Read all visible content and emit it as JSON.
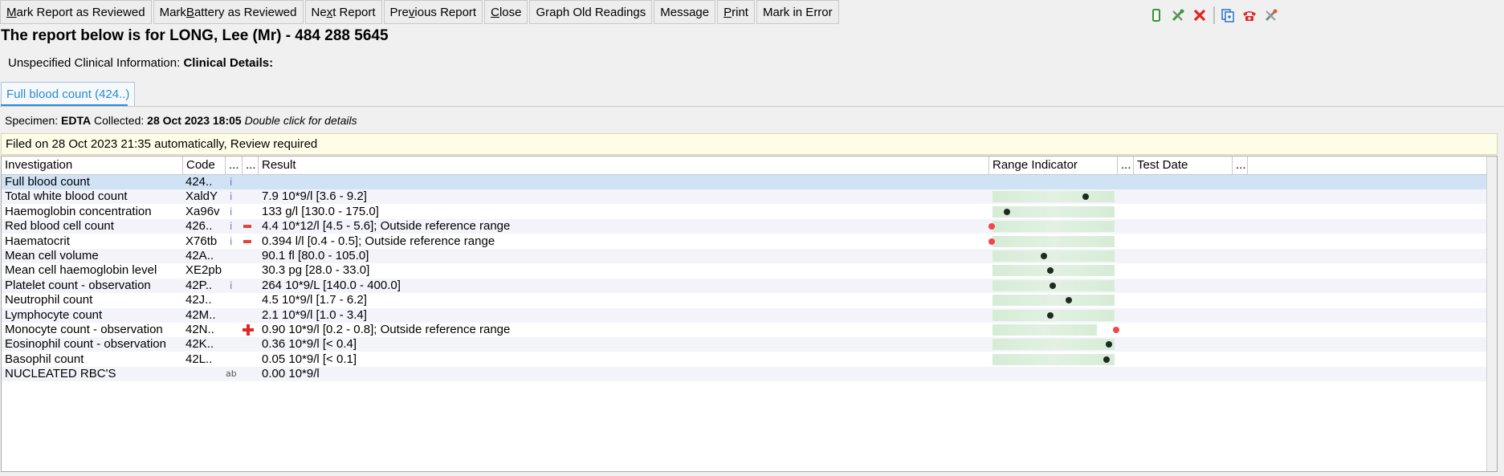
{
  "toolbar": {
    "buttons": [
      {
        "pre": "",
        "ul": "M",
        "post": "ark Report as Reviewed"
      },
      {
        "pre": "Mark ",
        "ul": "B",
        "post": "attery as Reviewed"
      },
      {
        "pre": "Ne",
        "ul": "x",
        "post": "t Report"
      },
      {
        "pre": "Pre",
        "ul": "v",
        "post": "ious Report"
      },
      {
        "pre": "",
        "ul": "C",
        "post": "lose"
      },
      {
        "pre": "Graph Old Readings",
        "ul": "",
        "post": ""
      },
      {
        "pre": "Message",
        "ul": "",
        "post": ""
      },
      {
        "pre": "",
        "ul": "P",
        "post": "rint"
      },
      {
        "pre": "Mark in Error",
        "ul": "",
        "post": ""
      }
    ],
    "icons": [
      "phone-icon",
      "tools-icon",
      "close-red-icon",
      "copy-icon",
      "telephone-icon",
      "tools-grey-icon"
    ]
  },
  "report_title": "The report below is for LONG, Lee (Mr) - 484 288 5645",
  "clinical": {
    "label": "Unspecified Clinical Information:",
    "value": "Clinical Details:"
  },
  "tab": {
    "label": "Full blood count (424..)"
  },
  "specimen": {
    "label": "Specimen:",
    "type": "EDTA",
    "collected_label": "Collected:",
    "collected": "28 Oct 2023 18:05",
    "hint": "Double click for details"
  },
  "filed_banner": "Filed on 28 Oct 2023 21:35 automatically, Review required",
  "grid": {
    "columns": [
      "Investigation",
      "Code",
      "...",
      "...",
      "Result",
      "Range Indicator",
      "...",
      "Test Date",
      "..."
    ],
    "rows": [
      {
        "investigation": "Full blood count",
        "code": "424..",
        "info": "i",
        "flag": "",
        "result": "",
        "range": null
      },
      {
        "investigation": "Total white blood count",
        "code": "XaldY",
        "info": "i",
        "flag": "",
        "result": "7.9 10*9/l [3.6 - 9.2]",
        "range": 0.77
      },
      {
        "investigation": "Haemoglobin concentration",
        "code": "Xa96v",
        "info": "i",
        "flag": "",
        "result": "133 g/l [130.0 - 175.0]",
        "range": 0.07
      },
      {
        "investigation": "Red blood cell count",
        "code": "426..",
        "info": "i",
        "flag": "low",
        "result": "4.4 10*12/l [4.5 - 5.6]; Outside reference range",
        "range": -0.1
      },
      {
        "investigation": "Haematocrit",
        "code": "X76tb",
        "info": "i",
        "flag": "low",
        "result": "0.394 l/l [0.4 - 0.5]; Outside reference range",
        "range": -0.1
      },
      {
        "investigation": "Mean cell volume",
        "code": "42A..",
        "info": "",
        "flag": "",
        "result": "90.1 fl [80.0 - 105.0]",
        "range": 0.4
      },
      {
        "investigation": "Mean cell haemoglobin level",
        "code": "XE2pb",
        "info": "",
        "flag": "",
        "result": "30.3 pg [28.0 - 33.0]",
        "range": 0.46
      },
      {
        "investigation": "Platelet count - observation",
        "code": "42P..",
        "info": "i",
        "flag": "",
        "result": "264 10*9/L [140.0 - 400.0]",
        "range": 0.48
      },
      {
        "investigation": "Neutrophil count",
        "code": "42J..",
        "info": "",
        "flag": "",
        "result": "4.5 10*9/l [1.7 - 6.2]",
        "range": 0.62
      },
      {
        "investigation": "Lymphocyte count",
        "code": "42M..",
        "info": "",
        "flag": "",
        "result": "2.1 10*9/l [1.0 - 3.4]",
        "range": 0.46
      },
      {
        "investigation": "Monocyte count - observation",
        "code": "42N..",
        "info": "",
        "flag": "high",
        "result": "0.90 10*9/l [0.2 - 0.8]; Outside reference range",
        "range": 1.0
      },
      {
        "investigation": "Eosinophil count - observation",
        "code": "42K..",
        "info": "",
        "flag": "",
        "result": "0.36 10*9/l [< 0.4]",
        "range": 0.98
      },
      {
        "investigation": "Basophil count",
        "code": "42L..",
        "info": "",
        "flag": "",
        "result": "0.05 10*9/l [< 0.1]",
        "range": 0.96
      },
      {
        "investigation": "NUCLEATED RBC'S",
        "code": "",
        "info": "ab",
        "flag": "",
        "result": "0.00 10*9/l",
        "range": null
      }
    ]
  },
  "colors": {
    "accent": "#2a8ad4",
    "low_flag": "#e84040",
    "high_flag": "#e02828",
    "range_bar": "#d6ecd6",
    "selected_row": "#d0e3f5"
  }
}
